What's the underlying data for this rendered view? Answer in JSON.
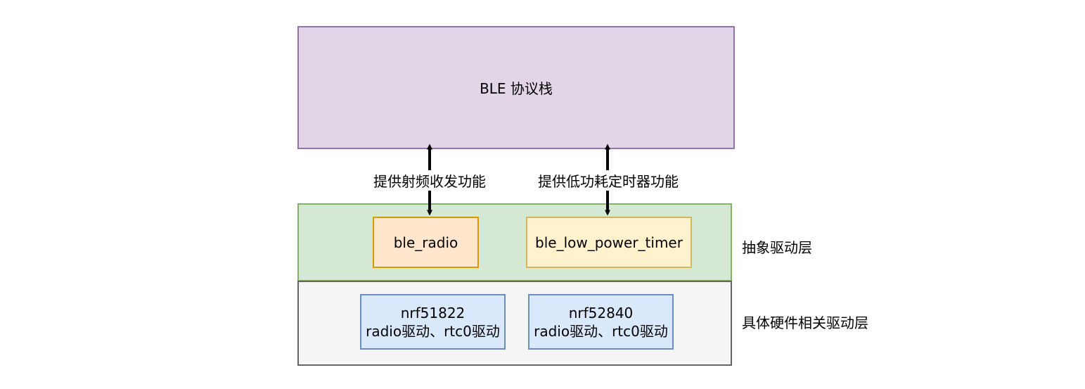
{
  "diagram": {
    "top_block": {
      "label": "BLE 协议栈"
    },
    "abstract_layer": {
      "side_label": "抽象驱动层",
      "modules": [
        {
          "label": "ble_radio"
        },
        {
          "label": "ble_low_power_timer"
        }
      ]
    },
    "hardware_layer": {
      "side_label": "具体硬件相关驱动层",
      "modules": [
        {
          "chip": "nrf51822",
          "drivers": "radio驱动、rtc0驱动"
        },
        {
          "chip": "nrf52840",
          "drivers": "radio驱动、rtc0驱动"
        }
      ]
    },
    "connections": [
      {
        "label": "提供射频收发功能"
      },
      {
        "label": "提供低功耗定时器功能"
      }
    ],
    "colors": {
      "stack_fill": "#e1d5e7",
      "stack_stroke": "#9673a6",
      "abstract_fill": "#d5e8d4",
      "abstract_stroke": "#82b366",
      "hw_fill": "#f5f5f5",
      "hw_stroke": "#666666",
      "radio_fill": "#ffe6cc",
      "radio_stroke": "#d79b00",
      "timer_fill": "#fff2cc",
      "timer_stroke": "#d6b656",
      "chip_fill": "#dae8fc",
      "chip_stroke": "#6c8ebf"
    }
  }
}
